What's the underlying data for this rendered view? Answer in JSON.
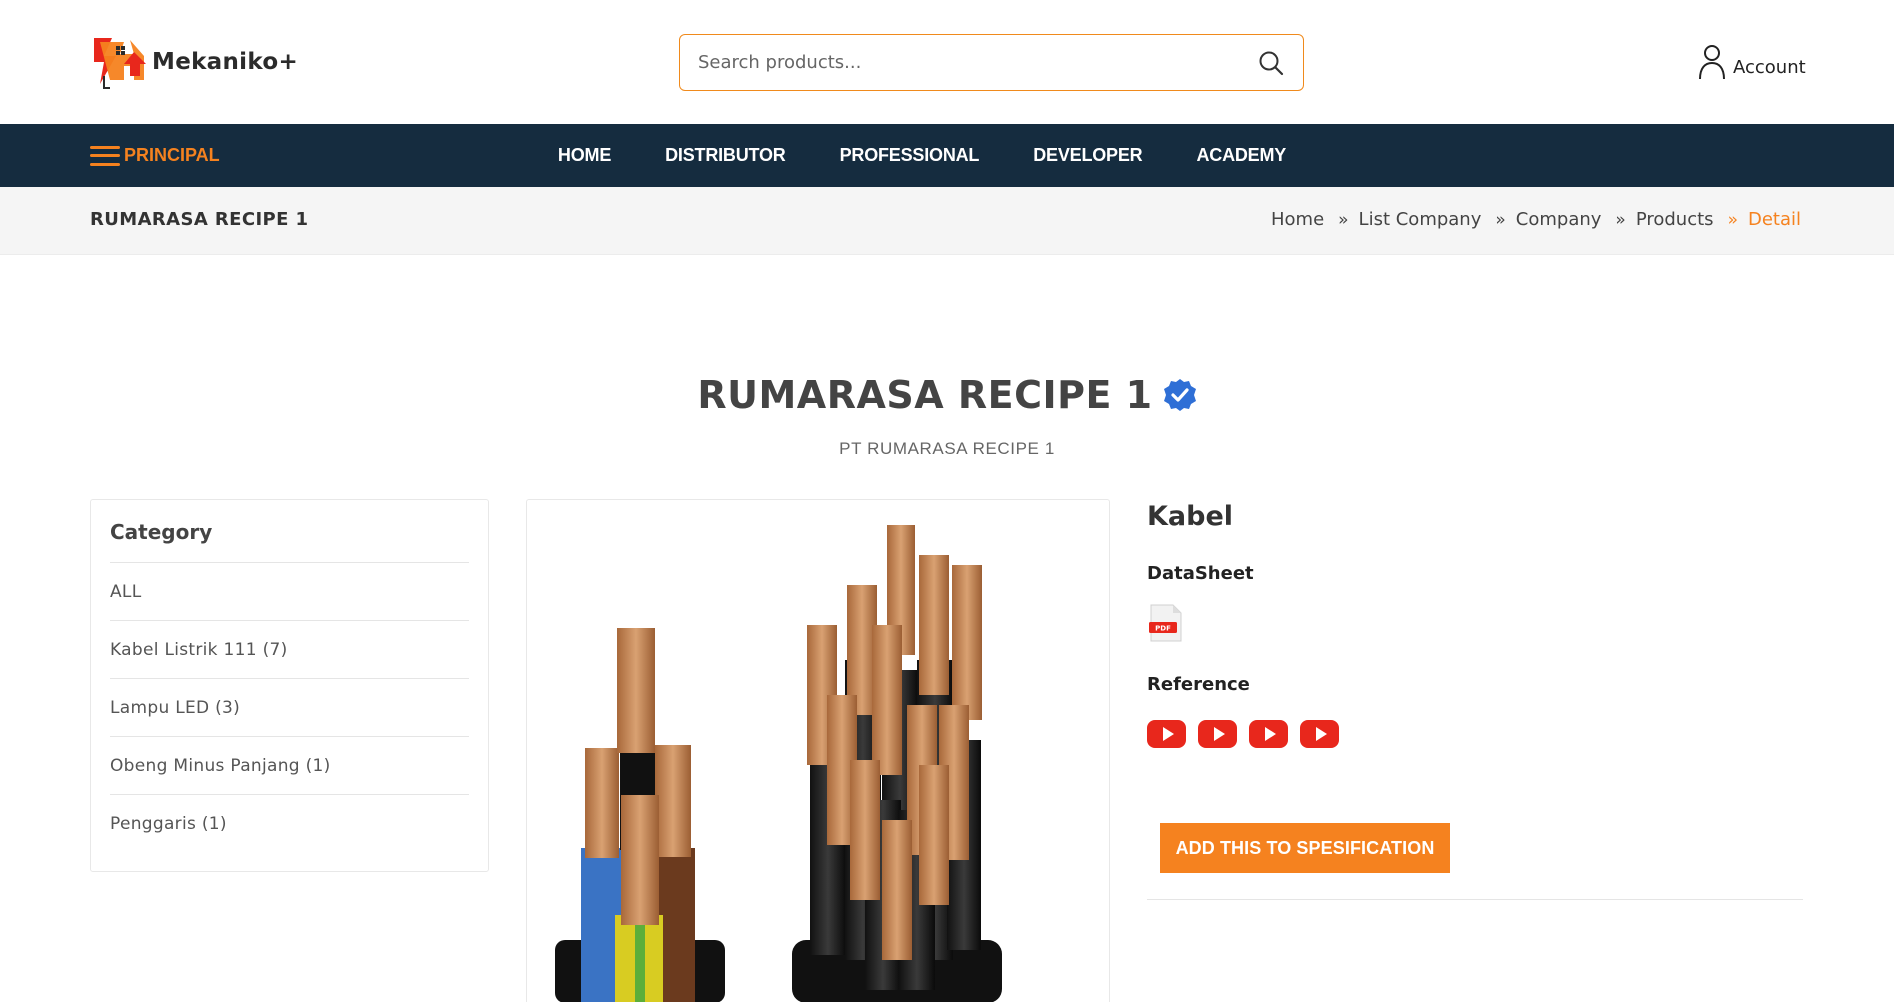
{
  "brand": {
    "name": "Mekaniko+"
  },
  "search": {
    "placeholder": "Search products..."
  },
  "account": {
    "label": "Account"
  },
  "nav": {
    "principal": "PRINCIPAL",
    "items": [
      "HOME",
      "DISTRIBUTOR",
      "PROFESSIONAL",
      "DEVELOPER",
      "ACADEMY"
    ]
  },
  "page": {
    "title": "RUMARASA RECIPE 1",
    "breadcrumb": [
      "Home",
      "List Company",
      "Company",
      "Products",
      "Detail"
    ]
  },
  "company": {
    "name": "RUMARASA RECIPE 1",
    "legal_name": "PT RUMARASA RECIPE 1",
    "verified": true
  },
  "category": {
    "heading": "Category",
    "items": [
      "ALL",
      "Kabel Listrik 111 (7)",
      "Lampu LED (3)",
      "Obeng Minus Panjang (1)",
      "Penggaris (1)"
    ]
  },
  "product": {
    "name": "Kabel",
    "datasheet_label": "DataSheet",
    "pdf_label": "PDF",
    "reference_label": "Reference",
    "reference_count": 4,
    "add_button": "ADD THIS TO SPESIFICATION"
  },
  "colors": {
    "accent": "#f5821f",
    "nav_bg": "#152c3f",
    "verified": "#2f6fd6",
    "youtube": "#e8271c"
  }
}
